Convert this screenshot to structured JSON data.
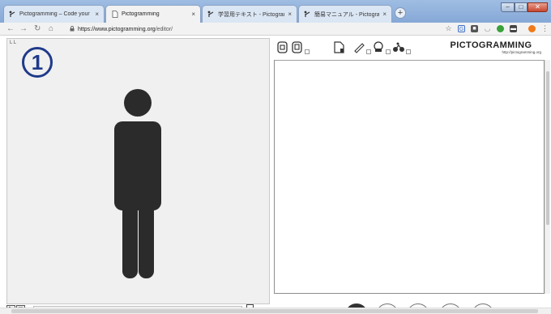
{
  "browser": {
    "tabs": [
      {
        "title": "Pictogramming – Code your p",
        "icon": "pictogramming-favicon",
        "active": false
      },
      {
        "title": "Pictogramming",
        "icon": "document-icon",
        "active": true
      },
      {
        "title": "学習用テキスト - Pictogramm",
        "icon": "pictogramming-favicon",
        "active": false
      },
      {
        "title": "簡易マニュアル - Pictogramm",
        "icon": "pictogramming-favicon",
        "active": false
      }
    ],
    "tab_close_glyph": "×",
    "new_tab_glyph": "+",
    "url_host": "https://www.pictogramming.org",
    "url_path": "/editor/",
    "window_controls": {
      "minimize": "–",
      "maximize": "□",
      "close": "✕"
    },
    "extension_icons": [
      "star-icon",
      "translate-icon",
      "extension-icon",
      "pocket-icon",
      "green-dot-icon",
      "chat-icon",
      "profile-avatar-icon"
    ]
  },
  "editor": {
    "stage_corner_label": "L L",
    "step_badge": "1",
    "app_logo_title": "PICTOGRAMMING",
    "app_logo_url": "http://pictogramming.org",
    "figure_color": "#2b2b2b",
    "accent_color": "#1f3a8a",
    "toolbar_icons": [
      "new-file-icon",
      "open-file-icon",
      "page-icon",
      "ruler-icon",
      "stamp-icon",
      "bicycle-icon"
    ],
    "bottom_left_icons": [
      "zoom-icon",
      "frame-icon"
    ],
    "code_text": "",
    "command_input_value": ""
  }
}
